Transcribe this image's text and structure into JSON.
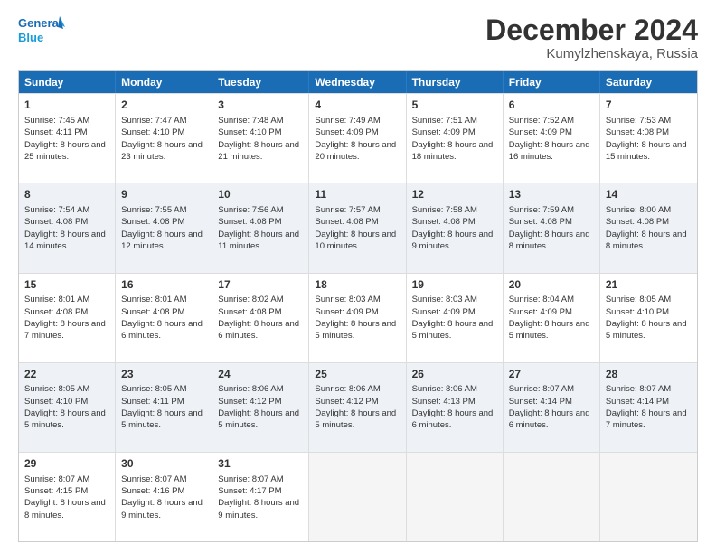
{
  "header": {
    "logo_line1": "General",
    "logo_line2": "Blue",
    "month_title": "December 2024",
    "location": "Kumylzhenskaya, Russia"
  },
  "days_of_week": [
    "Sunday",
    "Monday",
    "Tuesday",
    "Wednesday",
    "Thursday",
    "Friday",
    "Saturday"
  ],
  "weeks": [
    [
      {
        "day": "1",
        "sunrise": "7:45 AM",
        "sunset": "4:11 PM",
        "daylight": "8 hours and 25 minutes."
      },
      {
        "day": "2",
        "sunrise": "7:47 AM",
        "sunset": "4:10 PM",
        "daylight": "8 hours and 23 minutes."
      },
      {
        "day": "3",
        "sunrise": "7:48 AM",
        "sunset": "4:10 PM",
        "daylight": "8 hours and 21 minutes."
      },
      {
        "day": "4",
        "sunrise": "7:49 AM",
        "sunset": "4:09 PM",
        "daylight": "8 hours and 20 minutes."
      },
      {
        "day": "5",
        "sunrise": "7:51 AM",
        "sunset": "4:09 PM",
        "daylight": "8 hours and 18 minutes."
      },
      {
        "day": "6",
        "sunrise": "7:52 AM",
        "sunset": "4:09 PM",
        "daylight": "8 hours and 16 minutes."
      },
      {
        "day": "7",
        "sunrise": "7:53 AM",
        "sunset": "4:08 PM",
        "daylight": "8 hours and 15 minutes."
      }
    ],
    [
      {
        "day": "8",
        "sunrise": "7:54 AM",
        "sunset": "4:08 PM",
        "daylight": "8 hours and 14 minutes."
      },
      {
        "day": "9",
        "sunrise": "7:55 AM",
        "sunset": "4:08 PM",
        "daylight": "8 hours and 12 minutes."
      },
      {
        "day": "10",
        "sunrise": "7:56 AM",
        "sunset": "4:08 PM",
        "daylight": "8 hours and 11 minutes."
      },
      {
        "day": "11",
        "sunrise": "7:57 AM",
        "sunset": "4:08 PM",
        "daylight": "8 hours and 10 minutes."
      },
      {
        "day": "12",
        "sunrise": "7:58 AM",
        "sunset": "4:08 PM",
        "daylight": "8 hours and 9 minutes."
      },
      {
        "day": "13",
        "sunrise": "7:59 AM",
        "sunset": "4:08 PM",
        "daylight": "8 hours and 8 minutes."
      },
      {
        "day": "14",
        "sunrise": "8:00 AM",
        "sunset": "4:08 PM",
        "daylight": "8 hours and 8 minutes."
      }
    ],
    [
      {
        "day": "15",
        "sunrise": "8:01 AM",
        "sunset": "4:08 PM",
        "daylight": "8 hours and 7 minutes."
      },
      {
        "day": "16",
        "sunrise": "8:01 AM",
        "sunset": "4:08 PM",
        "daylight": "8 hours and 6 minutes."
      },
      {
        "day": "17",
        "sunrise": "8:02 AM",
        "sunset": "4:08 PM",
        "daylight": "8 hours and 6 minutes."
      },
      {
        "day": "18",
        "sunrise": "8:03 AM",
        "sunset": "4:09 PM",
        "daylight": "8 hours and 5 minutes."
      },
      {
        "day": "19",
        "sunrise": "8:03 AM",
        "sunset": "4:09 PM",
        "daylight": "8 hours and 5 minutes."
      },
      {
        "day": "20",
        "sunrise": "8:04 AM",
        "sunset": "4:09 PM",
        "daylight": "8 hours and 5 minutes."
      },
      {
        "day": "21",
        "sunrise": "8:05 AM",
        "sunset": "4:10 PM",
        "daylight": "8 hours and 5 minutes."
      }
    ],
    [
      {
        "day": "22",
        "sunrise": "8:05 AM",
        "sunset": "4:10 PM",
        "daylight": "8 hours and 5 minutes."
      },
      {
        "day": "23",
        "sunrise": "8:05 AM",
        "sunset": "4:11 PM",
        "daylight": "8 hours and 5 minutes."
      },
      {
        "day": "24",
        "sunrise": "8:06 AM",
        "sunset": "4:12 PM",
        "daylight": "8 hours and 5 minutes."
      },
      {
        "day": "25",
        "sunrise": "8:06 AM",
        "sunset": "4:12 PM",
        "daylight": "8 hours and 5 minutes."
      },
      {
        "day": "26",
        "sunrise": "8:06 AM",
        "sunset": "4:13 PM",
        "daylight": "8 hours and 6 minutes."
      },
      {
        "day": "27",
        "sunrise": "8:07 AM",
        "sunset": "4:14 PM",
        "daylight": "8 hours and 6 minutes."
      },
      {
        "day": "28",
        "sunrise": "8:07 AM",
        "sunset": "4:14 PM",
        "daylight": "8 hours and 7 minutes."
      }
    ],
    [
      {
        "day": "29",
        "sunrise": "8:07 AM",
        "sunset": "4:15 PM",
        "daylight": "8 hours and 8 minutes."
      },
      {
        "day": "30",
        "sunrise": "8:07 AM",
        "sunset": "4:16 PM",
        "daylight": "8 hours and 9 minutes."
      },
      {
        "day": "31",
        "sunrise": "8:07 AM",
        "sunset": "4:17 PM",
        "daylight": "8 hours and 9 minutes."
      },
      null,
      null,
      null,
      null
    ]
  ]
}
